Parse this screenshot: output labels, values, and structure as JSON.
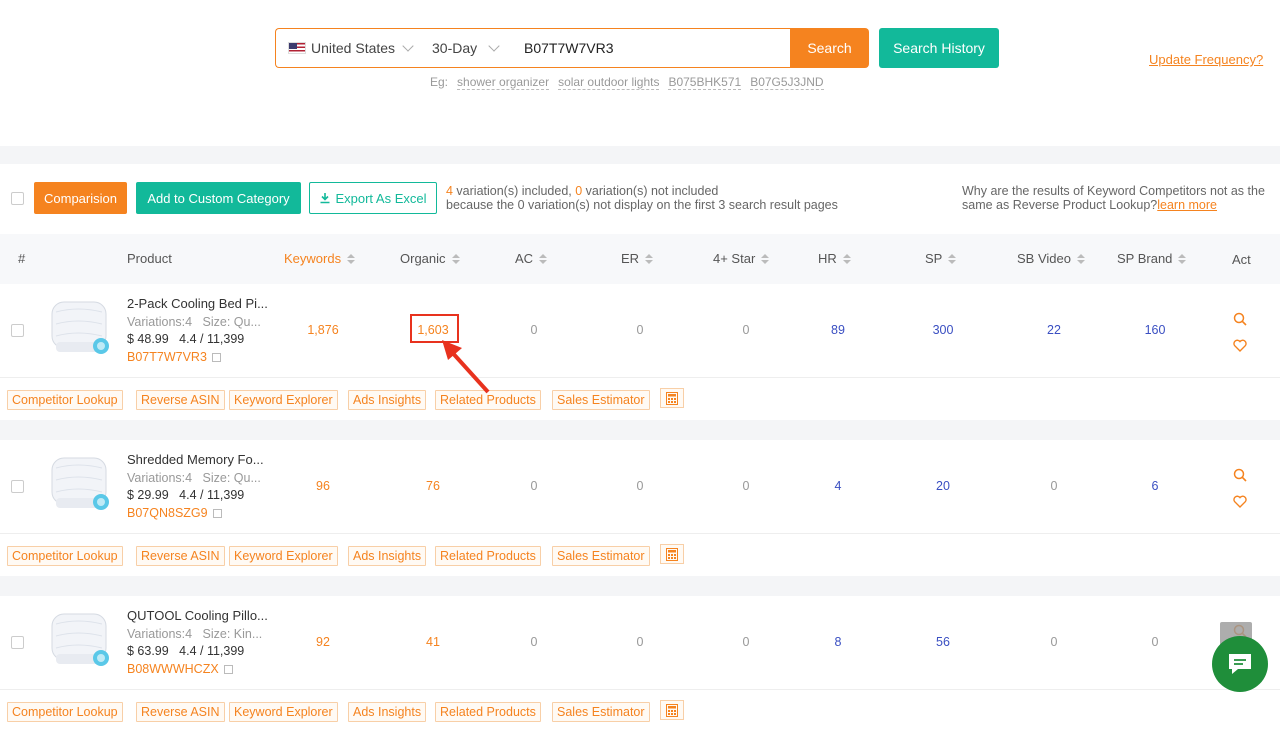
{
  "search": {
    "country": "United States",
    "period": "30-Day",
    "asin_value": "B07T7W7VR3",
    "search_label": "Search",
    "history_label": "Search History",
    "update_link": "Update Frequency?",
    "examples_prefix": "Eg:",
    "examples": [
      "shower organizer",
      "solar outdoor lights",
      "B075BHK571",
      "B07G5J3JND"
    ]
  },
  "toolbar": {
    "comparison_label": "Comparision",
    "custom_category_label": "Add to Custom Category",
    "export_label": "Export As Excel",
    "included_count": "4",
    "included_text": " variation(s) included, ",
    "not_included_count": "0",
    "not_included_text": " variation(s) not included",
    "variation_line2": "because the 0 variation(s) not display on the first 3 search result pages",
    "why_text": "Why are the results of Keyword Competitors not as the same as Reverse Product Lookup?",
    "learn_more": "learn more"
  },
  "columns": {
    "index": "#",
    "product": "Product",
    "keywords": "Keywords",
    "organic": "Organic",
    "ac": "AC",
    "er": "ER",
    "four_star": "4+ Star",
    "hr": "HR",
    "sp": "SP",
    "sb_video": "SB Video",
    "sp_brand": "SP Brand",
    "act": "Act"
  },
  "rows": [
    {
      "name": "2-Pack Cooling Bed Pi...",
      "variations": "Variations:4",
      "size": "Size: Qu...",
      "price": "$ 48.99",
      "rating": "4.4",
      "reviews": "11,399",
      "asin": "B07T7W7VR3",
      "keywords": "1,876",
      "organic": "1,603",
      "ac": "0",
      "er": "0",
      "four_star": "0",
      "hr": "89",
      "sp": "300",
      "sb_video": "22",
      "sp_brand": "160"
    },
    {
      "name": "Shredded Memory Fo...",
      "variations": "Variations:4",
      "size": "Size: Qu...",
      "price": "$ 29.99",
      "rating": "4.4",
      "reviews": "11,399",
      "asin": "B07QN8SZG9",
      "keywords": "96",
      "organic": "76",
      "ac": "0",
      "er": "0",
      "four_star": "0",
      "hr": "4",
      "sp": "20",
      "sb_video": "0",
      "sp_brand": "6"
    },
    {
      "name": "QUTOOL Cooling Pillo...",
      "variations": "Variations:4",
      "size": "Size: Kin...",
      "price": "$ 63.99",
      "rating": "4.4",
      "reviews": "11,399",
      "asin": "B08WWWHCZX",
      "keywords": "92",
      "organic": "41",
      "ac": "0",
      "er": "0",
      "four_star": "0",
      "hr": "8",
      "sp": "56",
      "sb_video": "0",
      "sp_brand": "0"
    }
  ],
  "tools": [
    "Competitor Lookup",
    "Reverse ASIN",
    "Keyword Explorer",
    "Ads Insights",
    "Related Products",
    "Sales Estimator"
  ],
  "colors": {
    "accent": "#f5831f",
    "green": "#12b99a",
    "blue": "#3a4fc2",
    "highlight": "#e8321e"
  }
}
